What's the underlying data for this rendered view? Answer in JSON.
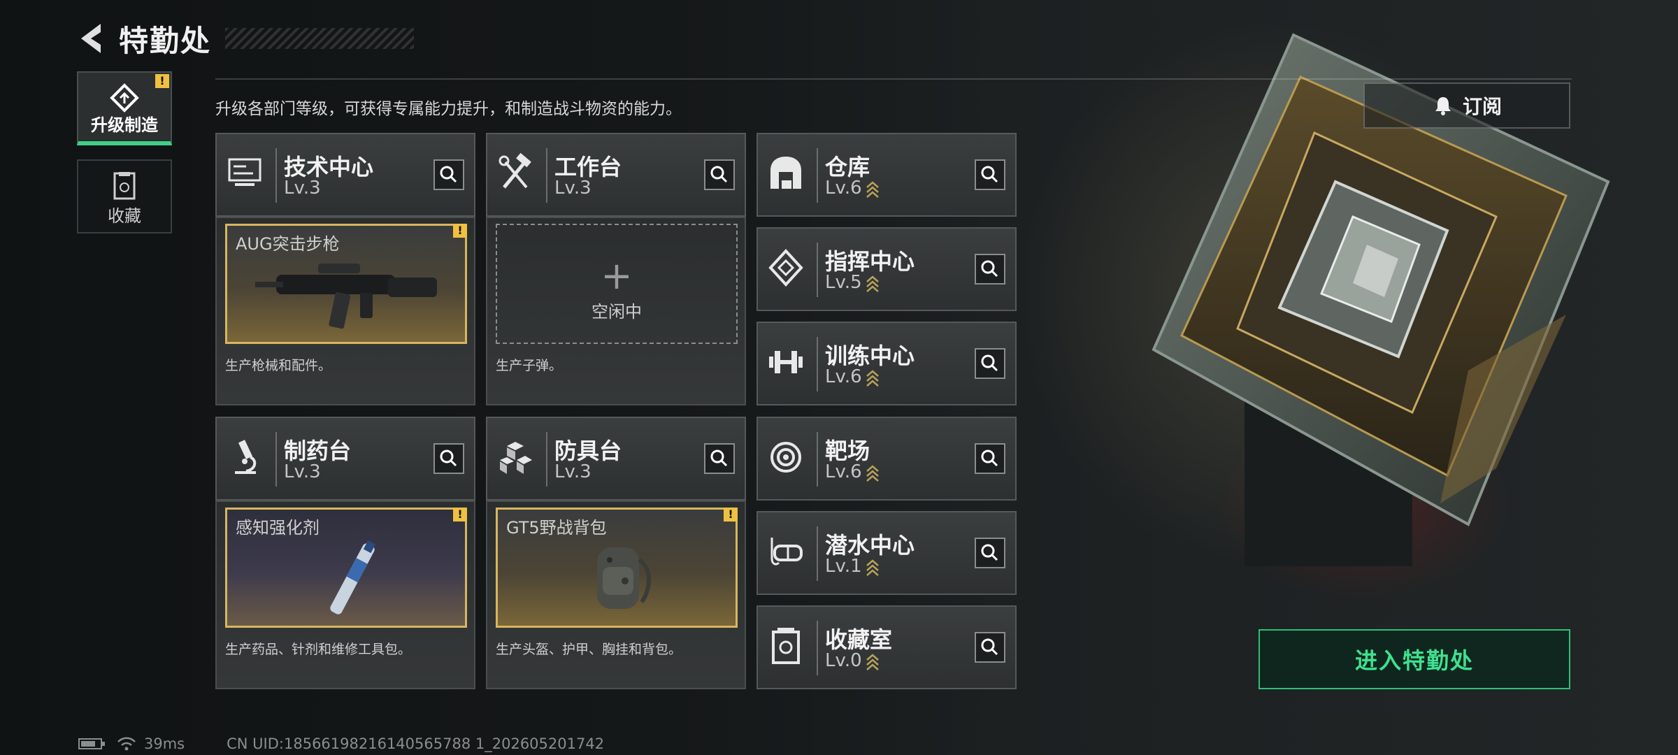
{
  "header": {
    "title": "特勤处"
  },
  "sidebar": {
    "items": [
      {
        "label": "升级制造",
        "active": true,
        "badge": "!"
      },
      {
        "label": "收藏",
        "active": false
      }
    ]
  },
  "hint": "升级各部门等级，可获得专属能力提升，和制造战斗物资的能力。",
  "subscribe_label": "订阅",
  "departments": [
    {
      "name": "技术中心",
      "level": "Lv.3",
      "icon": "monitor-icon"
    },
    {
      "name": "工作台",
      "level": "Lv.3",
      "icon": "hammer-wrench-icon"
    },
    {
      "name": "制药台",
      "level": "Lv.3",
      "icon": "microscope-icon"
    },
    {
      "name": "防具台",
      "level": "Lv.3",
      "icon": "armor-blocks-icon"
    },
    {
      "name": "仓库",
      "level": "Lv.6",
      "icon": "warehouse-icon",
      "upgradable": true
    },
    {
      "name": "指挥中心",
      "level": "Lv.5",
      "icon": "command-diamond-icon",
      "upgradable": true
    },
    {
      "name": "训练中心",
      "level": "Lv.6",
      "icon": "dumbbell-icon",
      "upgradable": true
    },
    {
      "name": "靶场",
      "level": "Lv.6",
      "icon": "target-icon",
      "upgradable": true
    },
    {
      "name": "潜水中心",
      "level": "Lv.1",
      "icon": "diving-mask-icon",
      "upgradable": true
    },
    {
      "name": "收藏室",
      "level": "Lv.0",
      "icon": "collection-icon",
      "upgradable": true
    }
  ],
  "production": [
    {
      "item": "AUG突击步枪",
      "desc": "生产枪械和配件。",
      "state": "filled",
      "badge": "!"
    },
    {
      "item": "",
      "idle_label": "空闲中",
      "desc": "生产子弹。",
      "state": "empty"
    },
    {
      "item": "感知强化剂",
      "desc": "生产药品、针剂和维修工具包。",
      "state": "filled",
      "badge": "!"
    },
    {
      "item": "GT5野战背包",
      "desc": "生产头盔、护甲、胸挂和背包。",
      "state": "filled",
      "badge": "!"
    }
  ],
  "enter_label": "进入特勤处",
  "status": {
    "ping": "39ms",
    "uid": "CN UID:18566198216140565788 1_202605201742"
  },
  "colors": {
    "accent": "#3fcf87",
    "gold": "#d8b660",
    "warn": "#f0c040"
  }
}
